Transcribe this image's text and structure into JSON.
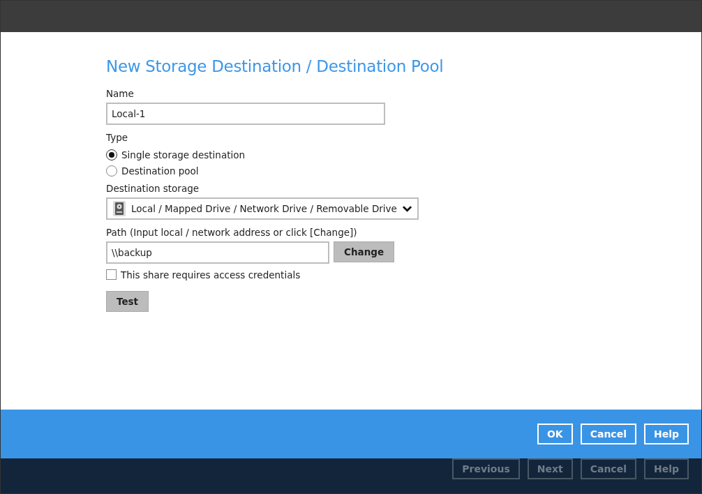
{
  "dialog": {
    "title": "New Storage Destination / Destination Pool"
  },
  "name_field": {
    "label": "Name",
    "value": "Local-1"
  },
  "type": {
    "label": "Type",
    "options": [
      {
        "label": "Single storage destination",
        "selected": true
      },
      {
        "label": "Destination pool",
        "selected": false
      }
    ]
  },
  "destination_storage": {
    "label": "Destination storage",
    "value": "Local / Mapped Drive / Network Drive / Removable Drive"
  },
  "path": {
    "label": "Path (Input local / network address or click [Change])",
    "value": "\\\\backup",
    "button": "Change"
  },
  "credentials": {
    "label": "This share requires access credentials",
    "checked": false
  },
  "test_button": "Test",
  "dialog_buttons": [
    "OK",
    "Cancel",
    "Help"
  ],
  "wizard_buttons": [
    {
      "label": "Previous",
      "disabled": true
    },
    {
      "label": "Next",
      "disabled": true
    },
    {
      "label": "Cancel",
      "disabled": true
    },
    {
      "label": "Help",
      "disabled": true
    }
  ]
}
